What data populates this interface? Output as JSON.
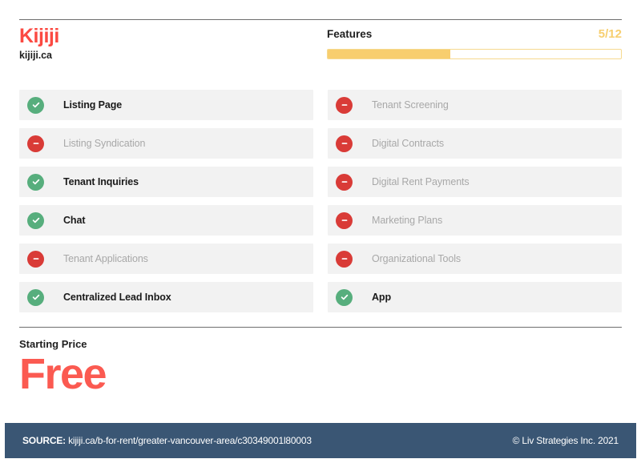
{
  "brand": {
    "name": "Kijiji",
    "url": "kijiji.ca",
    "color": "#fb4a42"
  },
  "features_header": {
    "label": "Features",
    "count_text": "5/12",
    "count_enabled": 5,
    "count_total": 12,
    "progress_percent": 41.7,
    "fill_color": "#f8ce6e",
    "track_border_color": "#f6d98f"
  },
  "icons": {
    "yes": "check-circle-icon",
    "no": "minus-circle-icon",
    "yes_color": "#57ae7d",
    "no_color": "#d93b37"
  },
  "features": {
    "left_column": [
      {
        "label": "Listing Page",
        "enabled": true
      },
      {
        "label": "Listing Syndication",
        "enabled": false
      },
      {
        "label": "Tenant Inquiries",
        "enabled": true
      },
      {
        "label": "Chat",
        "enabled": true
      },
      {
        "label": "Tenant Applications",
        "enabled": false
      },
      {
        "label": "Centralized Lead Inbox",
        "enabled": true
      }
    ],
    "right_column": [
      {
        "label": "Tenant Screening",
        "enabled": false
      },
      {
        "label": "Digital Contracts",
        "enabled": false
      },
      {
        "label": "Digital Rent Payments",
        "enabled": false
      },
      {
        "label": "Marketing Plans",
        "enabled": false
      },
      {
        "label": "Organizational Tools",
        "enabled": false
      },
      {
        "label": "App",
        "enabled": true
      }
    ]
  },
  "price": {
    "caption": "Starting Price",
    "value": "Free",
    "color": "#fb5a51"
  },
  "footer": {
    "source_label": "SOURCE:",
    "source_url": "kijiji.ca/b-for-rent/greater-vancouver-area/c30349001l80003",
    "copyright": "© Liv Strategies Inc. 2021",
    "background": "#3a5674"
  }
}
